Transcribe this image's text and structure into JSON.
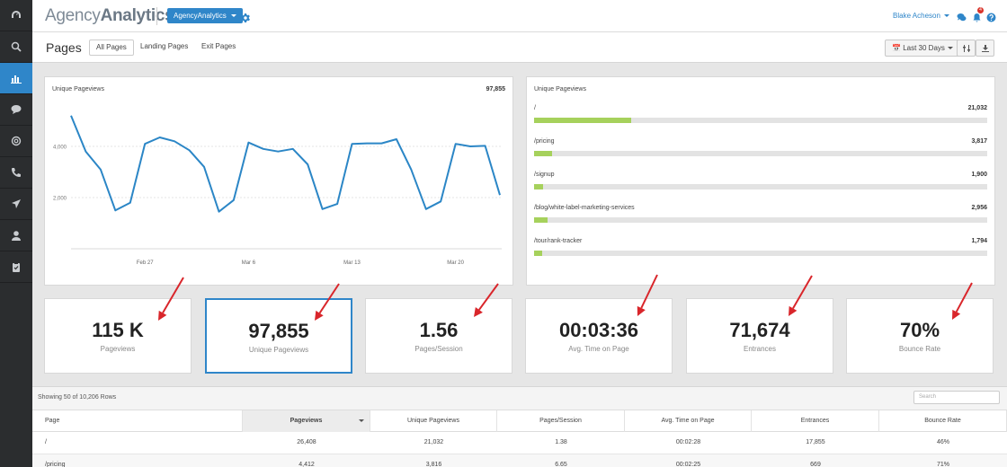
{
  "header": {
    "logo_light": "Agency",
    "logo_bold": "Analytics",
    "agency_button": "AgencyAnalytics",
    "user_name": "Blake Acheson",
    "notification_count": "4"
  },
  "sidebar": {
    "items": [
      {
        "icon": "dashboard-icon"
      },
      {
        "icon": "search-icon"
      },
      {
        "icon": "bar-chart-icon",
        "active": true
      },
      {
        "icon": "chat-icon"
      },
      {
        "icon": "at-icon"
      },
      {
        "icon": "phone-icon"
      },
      {
        "icon": "paper-plane-icon"
      },
      {
        "icon": "user-icon"
      },
      {
        "icon": "clipboard-icon"
      }
    ]
  },
  "page": {
    "title": "Pages",
    "tabs": [
      "All Pages",
      "Landing Pages",
      "Exit Pages"
    ],
    "active_tab": 0,
    "date_range": "Last 30 Days"
  },
  "line_card": {
    "title": "Unique Pageviews",
    "total": "97,855"
  },
  "chart_data": {
    "type": "line",
    "title": "Unique Pageviews",
    "y_ticks": [
      2000,
      4000
    ],
    "y_tick_labels": [
      "2,000",
      "4,000"
    ],
    "x_tick_labels": [
      "Feb 27",
      "Mar 6",
      "Mar 13",
      "Mar 20"
    ],
    "x_tick_index": [
      5,
      12,
      19,
      26
    ],
    "ylim": [
      0,
      6000
    ],
    "series": [
      {
        "values": [
          5200,
          3800,
          3100,
          1500,
          1800,
          4100,
          4350,
          4200,
          3850,
          3200,
          1450,
          1900,
          4150,
          3900,
          3800,
          3900,
          3300,
          1550,
          1750,
          4100,
          4120,
          4120,
          4280,
          3100,
          1550,
          1850,
          4100,
          4000,
          4020,
          2100
        ]
      }
    ],
    "color": "#2b86c6",
    "grid": true
  },
  "bar_card": {
    "title": "Unique Pageviews",
    "max": 97855,
    "rows": [
      {
        "label": "/",
        "value": "21,032",
        "num": 21032
      },
      {
        "label": "/pricing",
        "value": "3,817",
        "num": 3817
      },
      {
        "label": "/signup",
        "value": "1,900",
        "num": 1900
      },
      {
        "label": "/blog/white-label-marketing-services",
        "value": "2,956",
        "num": 2956
      },
      {
        "label": "/tour/rank-tracker",
        "value": "1,794",
        "num": 1794
      }
    ]
  },
  "stats": [
    {
      "value": "115 K",
      "label": "Pageviews"
    },
    {
      "value": "97,855",
      "label": "Unique Pageviews",
      "active": true
    },
    {
      "value": "1.56",
      "label": "Pages/Session"
    },
    {
      "value": "00:03:36",
      "label": "Avg. Time on Page"
    },
    {
      "value": "71,674",
      "label": "Entrances"
    },
    {
      "value": "70%",
      "label": "Bounce Rate"
    }
  ],
  "table": {
    "info": "Showing 50 of 10,206 Rows",
    "search_placeholder": "Search",
    "columns": [
      "Page",
      "Pageviews",
      "Unique Pageviews",
      "Pages/Session",
      "Avg. Time on Page",
      "Entrances",
      "Bounce Rate"
    ],
    "sorted_column": 1,
    "rows": [
      [
        "/",
        "26,408",
        "21,032",
        "1.38",
        "00:02:28",
        "17,855",
        "46%"
      ],
      [
        "/pricing",
        "4,412",
        "3,816",
        "6.65",
        "00:02:25",
        "669",
        "71%"
      ]
    ]
  },
  "colors": {
    "accent": "#2f86c9",
    "bar_fill": "#a6d15c",
    "arrow": "#d9262b",
    "sidebar": "#2b2d2f"
  }
}
